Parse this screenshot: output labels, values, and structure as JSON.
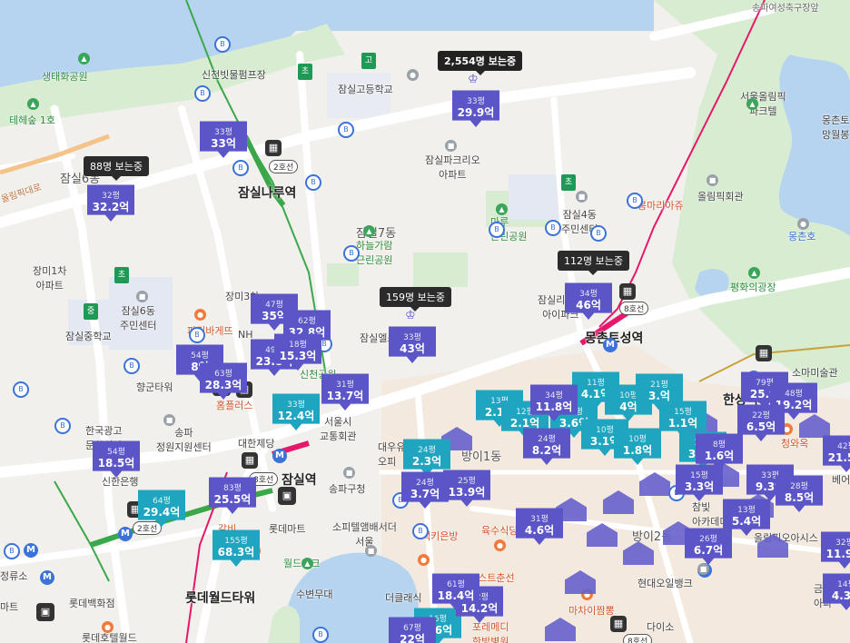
{
  "colors": {
    "water": "#b6d4f0",
    "park": "#d7ecd1",
    "road": "#ffffff",
    "violet": "#5b55c8",
    "teal": "#1fa5bf",
    "line2": "#35b24a",
    "line8": "#e6186c",
    "residential": "#f3e9df"
  },
  "labels": {
    "songpa_rd": "송파여성축구장앞",
    "eco_park": "생태화공원",
    "forest": "테헤숲 1호",
    "sincheon_pump": "신천빗물펌프장",
    "jamsil_high": "잠실고등학교",
    "olympic_park": "서울올림픽\n파크텔",
    "mongchon_toseong": "몽촌토\n망월봉",
    "jamsil6": "잠실6동",
    "trig": "잠실파크리오\n아파트",
    "jamsilnaru_stn": "잠실나루역",
    "ma_park": "마루\n근린공원",
    "bongmaria": "봉마리아쥬",
    "jamsil4_center": "잠실4동\n주민센터",
    "olympic_hall": "올림픽회관",
    "mongchonho": "몽촌호",
    "jangmi1": "장미1차\n아파트",
    "jamsil6_center": "잠실6동\n주민센터",
    "jamsil_middle": "잠실중학교",
    "jamsil_dong": "잠실7동",
    "haneul_park": "하늘가람\n근린공원",
    "jangmi3": "장미3차",
    "paris": "파리바게뜨",
    "jamsil_els": "잠실엘스",
    "jamsil_rich": "잠실리센츠\n아이파크",
    "mongchon_stn": "몽촌토성역",
    "peace_square": "평화의광장",
    "hyangun": "향군타워",
    "nh": "NH",
    "homeplus": "홈플러스",
    "sincheon_park": "신천공원",
    "soma": "소마미술관",
    "hanseong_stn": "한성백제역",
    "korea_ad": "한국광고\n문화회관",
    "songpa_info": "송파\n정원지원센터",
    "daehan": "대한제당",
    "seoul_bus": "서울시\n교통회관",
    "daewoo": "대우유\n오피",
    "cheonghwa": "청와옥",
    "shinhan": "신한은행",
    "jamsil_stn": "잠실역",
    "jamsil_stn2": "잠실역",
    "songpa_gu": "송파구청",
    "bangi1": "방이1동",
    "bangi2": "방이2동",
    "chambit": "참빛\n아카데미",
    "lotte_mart": "롯데마트",
    "galbi": "갈비",
    "sofitel": "소피텔앰배서더\n서울",
    "baekirongs": "백키은방",
    "yuksu": "육수식당",
    "olympic_oasis": "올림픽오아시스",
    "world_park": "월드파크",
    "lotte_tower": "롯데월드타워",
    "lotte_dept": "롯데백화점",
    "lotte_hotel": "롯데호텔월드",
    "susumu": "수변무대",
    "the_grand": "더클래식",
    "costchu": "코스트춘선",
    "hyundai_oil": "현대오일뱅크",
    "matai": "마차이짬뽕",
    "daiso": "다이소",
    "poremedi": "포레메디\n한방병원",
    "geumho": "금호어\n아파",
    "bear": "베어",
    "8line": "8호선",
    "2line": "2호선",
    "wolsum": "잠실중학교",
    "mart": "마트",
    "jeonglyuso": "정류소",
    "olympic_road": "올림픽대로"
  },
  "tooltips": [
    {
      "id": "t1",
      "text": "2,554명 보는중"
    },
    {
      "id": "t2",
      "text": "88명 보는중"
    },
    {
      "id": "t3",
      "text": "159명 보는중"
    },
    {
      "id": "t4",
      "text": "112명 보는중"
    }
  ],
  "pins": [
    {
      "area": "33평",
      "price": "33억"
    },
    {
      "area": "33평",
      "price": "29.9억"
    },
    {
      "area": "32평",
      "price": "32.2억"
    },
    {
      "area": "34평",
      "price": "46억"
    },
    {
      "area": "33평",
      "price": "43억"
    },
    {
      "area": "47평",
      "price": "35억"
    },
    {
      "area": "62평",
      "price": "32.8억"
    },
    {
      "area": "49평",
      "price": "23.8억"
    },
    {
      "area": "18평",
      "price": "15.3억"
    },
    {
      "area": "54평",
      "price": "8억"
    },
    {
      "area": "63평",
      "price": "28.3억"
    },
    {
      "area": "31평",
      "price": "13.7억"
    },
    {
      "area": "33평",
      "price": "12.4억"
    },
    {
      "area": "54평",
      "price": "18.5억"
    },
    {
      "area": "83평",
      "price": "25.5억"
    },
    {
      "area": "64평",
      "price": "29.4억"
    },
    {
      "area": "155평",
      "price": "68.3억"
    },
    {
      "area": "24평",
      "price": "2.3억"
    },
    {
      "area": "24평",
      "price": "3.7억"
    },
    {
      "area": "25평",
      "price": "13.9억"
    },
    {
      "area": "34평",
      "price": "11.8억"
    },
    {
      "area": "24평",
      "price": "8.2억"
    },
    {
      "area": "31평",
      "price": "4.6억"
    },
    {
      "area": "79평",
      "price": "25.억"
    },
    {
      "area": "48평",
      "price": "19.2억"
    },
    {
      "area": "22평",
      "price": "6.5억"
    },
    {
      "area": "8평",
      "price": "1.6억"
    },
    {
      "area": "15평",
      "price": "3.3억"
    },
    {
      "area": "33평",
      "price": "9.3억"
    },
    {
      "area": "28평",
      "price": "8.5억"
    },
    {
      "area": "26평",
      "price": "6.7억"
    },
    {
      "area": "13평",
      "price": "5.4억"
    },
    {
      "area": "42평",
      "price": "21.5억"
    },
    {
      "area": "32평",
      "price": "11.9억"
    },
    {
      "area": "32평",
      "price": "14.2억"
    },
    {
      "area": "61평",
      "price": "18.4억"
    },
    {
      "area": "16평",
      "price": "3.6억"
    },
    {
      "area": "67평",
      "price": "22억"
    },
    {
      "area": "14평",
      "price": "4.3억"
    },
    {
      "area": "11평",
      "price": "4.1억"
    },
    {
      "area": "10평",
      "price": "4억"
    },
    {
      "area": "10평",
      "price": "1.8억"
    },
    {
      "area": "13평",
      "price": "2.1억"
    },
    {
      "area": "10평",
      "price": "3.1억"
    },
    {
      "area": "13평",
      "price": "3.6억"
    },
    {
      "area": "12평",
      "price": "2.1억"
    },
    {
      "area": "15평",
      "price": "1.1억"
    },
    {
      "area": "21평",
      "price": "3.억"
    }
  ]
}
